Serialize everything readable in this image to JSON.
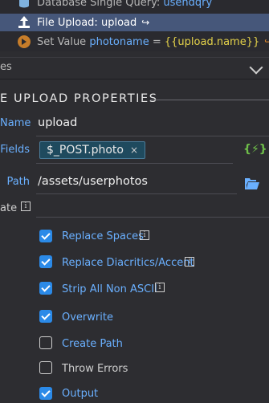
{
  "tree": {
    "row1": {
      "prefix": "Database Single Query:",
      "name": "usehdqry"
    },
    "row2": {
      "label": "File Upload:",
      "name": "upload"
    },
    "row3": {
      "label": "Set Value",
      "name": "photoname",
      "eq": "=",
      "expr": "{{upload.name}}"
    }
  },
  "section": {
    "label": "es"
  },
  "properties": {
    "title": "E UPLOAD PROPERTIES",
    "name_label": "Name",
    "name_value": "upload",
    "fields_label": "Fields",
    "fields_tag": "$_POST.photo",
    "fields_tag_close": "×",
    "dynamic_icon": "{⚡}",
    "path_label": "Path",
    "path_value": "/assets/userphotos",
    "template_label": "ate"
  },
  "options": [
    {
      "label": "Replace Spaces",
      "checked": true,
      "info": true
    },
    {
      "label": "Replace Diacritics/Accent",
      "checked": true,
      "info": true
    },
    {
      "label": "Strip All Non ASCII",
      "checked": true,
      "info": true
    },
    {
      "label": "Overwrite",
      "checked": true,
      "info": false
    },
    {
      "label": "Create Path",
      "checked": false,
      "info": false
    },
    {
      "label": "Throw Errors",
      "checked": false,
      "info": false
    },
    {
      "label": "Output",
      "checked": true,
      "info": false
    }
  ],
  "info_glyph": "i",
  "exit_glyph": "↪",
  "colors": {
    "accent": "#2b8ae8",
    "link": "#6ab0ff",
    "selected_row": "#46577a",
    "expression": "#e4d24a"
  }
}
